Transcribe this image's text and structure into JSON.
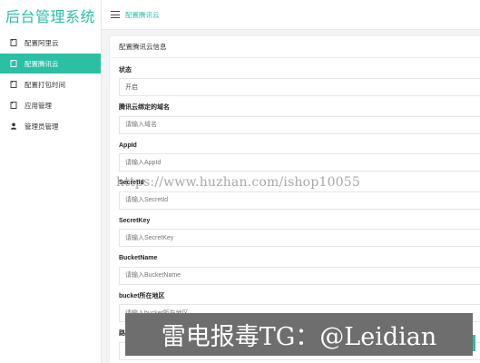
{
  "app": {
    "title": "后台管理系统"
  },
  "sidebar": {
    "items": [
      {
        "label": "配置阿里云",
        "icon": "file-icon",
        "active": false
      },
      {
        "label": "配置腾讯云",
        "icon": "file-icon",
        "active": true
      },
      {
        "label": "配置打包时间",
        "icon": "file-icon",
        "active": false
      },
      {
        "label": "应用管理",
        "icon": "file-icon",
        "active": false
      },
      {
        "label": "管理员管理",
        "icon": "user-icon",
        "active": false
      }
    ]
  },
  "topbar": {
    "breadcrumb": "配置腾讯云"
  },
  "panel": {
    "title": "配置腾讯云信息",
    "fields": [
      {
        "label": "状态",
        "value": "开启",
        "placeholder": ""
      },
      {
        "label": "腾讯云绑定的域名",
        "value": "",
        "placeholder": "请输入域名"
      },
      {
        "label": "AppId",
        "value": "",
        "placeholder": "请输入AppId"
      },
      {
        "label": "SecretId",
        "value": "",
        "placeholder": "请输入SecretId"
      },
      {
        "label": "SecretKey",
        "value": "",
        "placeholder": "请输入SecretKey"
      },
      {
        "label": "BucketName",
        "value": "",
        "placeholder": "请输入BucketName"
      },
      {
        "label": "bucket所在地区",
        "value": "",
        "placeholder": "请输入bucket所在地区"
      },
      {
        "label": "路径",
        "value": "",
        "placeholder": "path"
      }
    ]
  },
  "overlays": {
    "watermark": "https://www.huzhan.com/ishop10055",
    "banner": "雷电报毒TG：@Leidian"
  },
  "colors": {
    "accent": "#2bbfa4",
    "banner_bg": "#6e6e6e"
  }
}
